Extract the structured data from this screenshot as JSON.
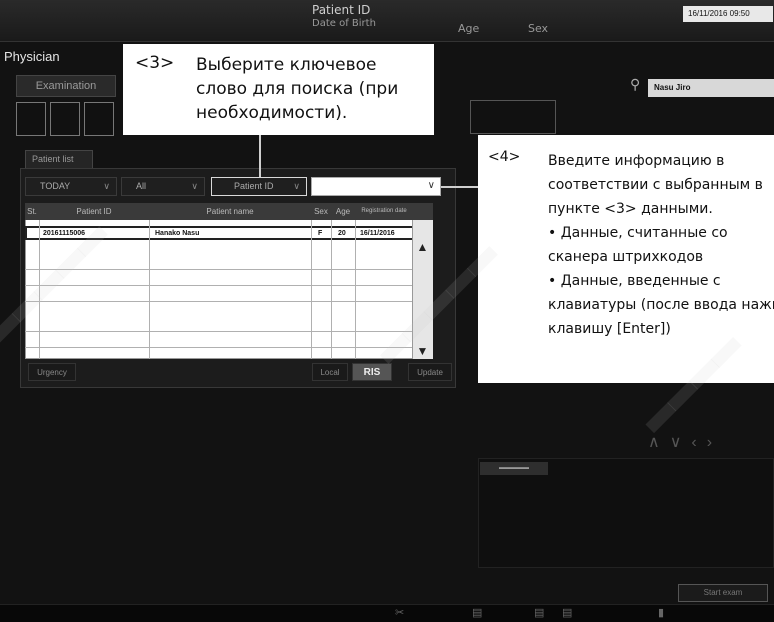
{
  "header": {
    "patient_id_label": "Patient ID",
    "dob_label": "Date of Birth",
    "age_label": "Age",
    "sex_label": "Sex",
    "datetime": "16/11/2016 09:50"
  },
  "left": {
    "physician": "Physician",
    "examination_tab": "Examination",
    "patient_list_tab": "Patient list"
  },
  "filters": {
    "day": "TODAY",
    "scope": "All",
    "key": "Patient ID",
    "search_value": ""
  },
  "table": {
    "columns": [
      "St.",
      "Patient ID",
      "Patient name",
      "Sex",
      "Age",
      "Registration date"
    ],
    "rows": [
      {
        "status": "",
        "patient_id": "20161115006",
        "name": "Hanako Nasu",
        "sex": "F",
        "age": "20",
        "reg_date": "16/11/2016"
      }
    ]
  },
  "buttons": {
    "urgency": "Urgency",
    "local": "Local",
    "ris": "RIS",
    "update": "Update",
    "start_exam": "Start exam"
  },
  "right": {
    "user_name": "Nasu Jiro"
  },
  "callout3": {
    "num": "<3>",
    "text": "Выберите ключевое слово для поиска (при необходимости)."
  },
  "callout4": {
    "num": "<4>",
    "lines": [
      "Введите информацию в",
      "соответствии с выбранным в",
      "пункте <3> данными.",
      "• Данные, считанные со",
      "сканера штрихкодов",
      "• Данные, введенные с",
      "клавиатуры (после ввода нажмите",
      "клавишу [Enter])"
    ]
  },
  "colors": {
    "background": "#121212",
    "callout_bg": "#ffffff",
    "table_bg": "#ffffff"
  }
}
